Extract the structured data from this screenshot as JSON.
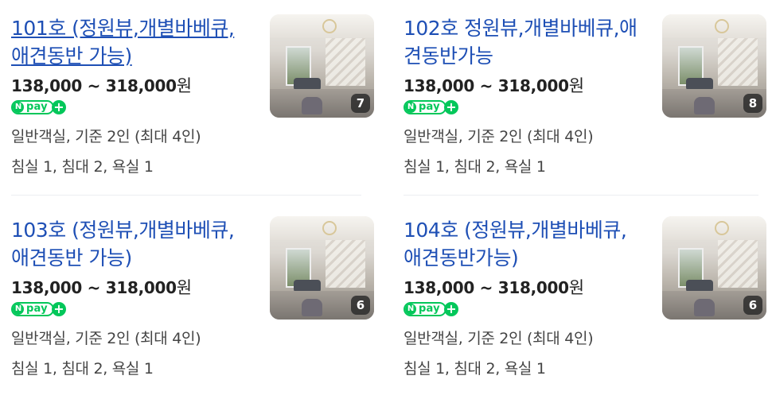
{
  "rooms": [
    {
      "title": "101호 (정원뷰,개별바베큐, 애견동반 가능)",
      "price_range": "138,000 ~ 318,000",
      "currency": "원",
      "pay_label": "pay",
      "pay_badge_n": "N",
      "pay_plus": "+",
      "info_line1": "일반객실, 기준 2인 (최대 4인)",
      "info_line2": "침실 1, 침대 2, 욕실 1",
      "photo_count": "7"
    },
    {
      "title": "102호 정원뷰,개별바베큐,애견동반가능",
      "price_range": "138,000 ~ 318,000",
      "currency": "원",
      "pay_label": "pay",
      "pay_badge_n": "N",
      "pay_plus": "+",
      "info_line1": "일반객실, 기준 2인 (최대 4인)",
      "info_line2": "침실 1, 침대 2, 욕실 1",
      "photo_count": "8"
    },
    {
      "title": "103호 (정원뷰,개별바베큐,애견동반 가능)",
      "price_range": "138,000 ~ 318,000",
      "currency": "원",
      "pay_label": "pay",
      "pay_badge_n": "N",
      "pay_plus": "+",
      "info_line1": "일반객실, 기준 2인 (최대 4인)",
      "info_line2": "침실 1, 침대 2, 욕실 1",
      "photo_count": "6"
    },
    {
      "title": "104호 (정원뷰,개별바베큐,애견동반가능)",
      "price_range": "138,000 ~ 318,000",
      "currency": "원",
      "pay_label": "pay",
      "pay_badge_n": "N",
      "pay_plus": "+",
      "info_line1": "일반객실, 기준 2인 (최대 4인)",
      "info_line2": "침실 1, 침대 2, 욕실 1",
      "photo_count": "6"
    }
  ],
  "colors": {
    "link": "#1e4fb5",
    "npay_green": "#03c75a",
    "text": "#444444"
  }
}
